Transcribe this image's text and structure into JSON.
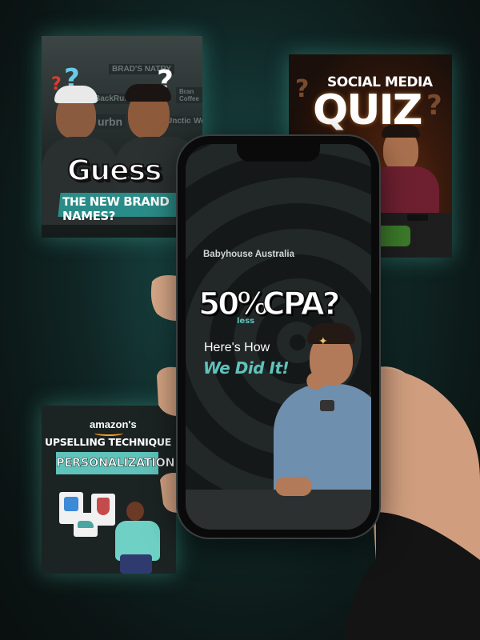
{
  "cards": {
    "guess": {
      "title": "Guess",
      "subtitle_prefix": "THE",
      "subtitle_main": "NEW BRAND NAMES?",
      "brand_tags": [
        "BRAD'S NATRY",
        "BackRun",
        "urbn",
        "Unction",
        "Web",
        "Bran Coffee"
      ],
      "accent": "#2a8c88"
    },
    "quiz": {
      "top": "SOCIAL MEDIA",
      "big": "QUIZ"
    },
    "amazon": {
      "brand": "amazon's",
      "line": "UPSELLING TECHNIQUE",
      "tag": "PERSONALIZATION",
      "accent": "#5fc3bb"
    }
  },
  "phone": {
    "brand": "Babyhouse Australia",
    "percent": "50%",
    "less": "less",
    "cpa": "CPA?",
    "heres": "Here's How",
    "wedid": "We Did It!",
    "accent": "#5fc3bb"
  }
}
